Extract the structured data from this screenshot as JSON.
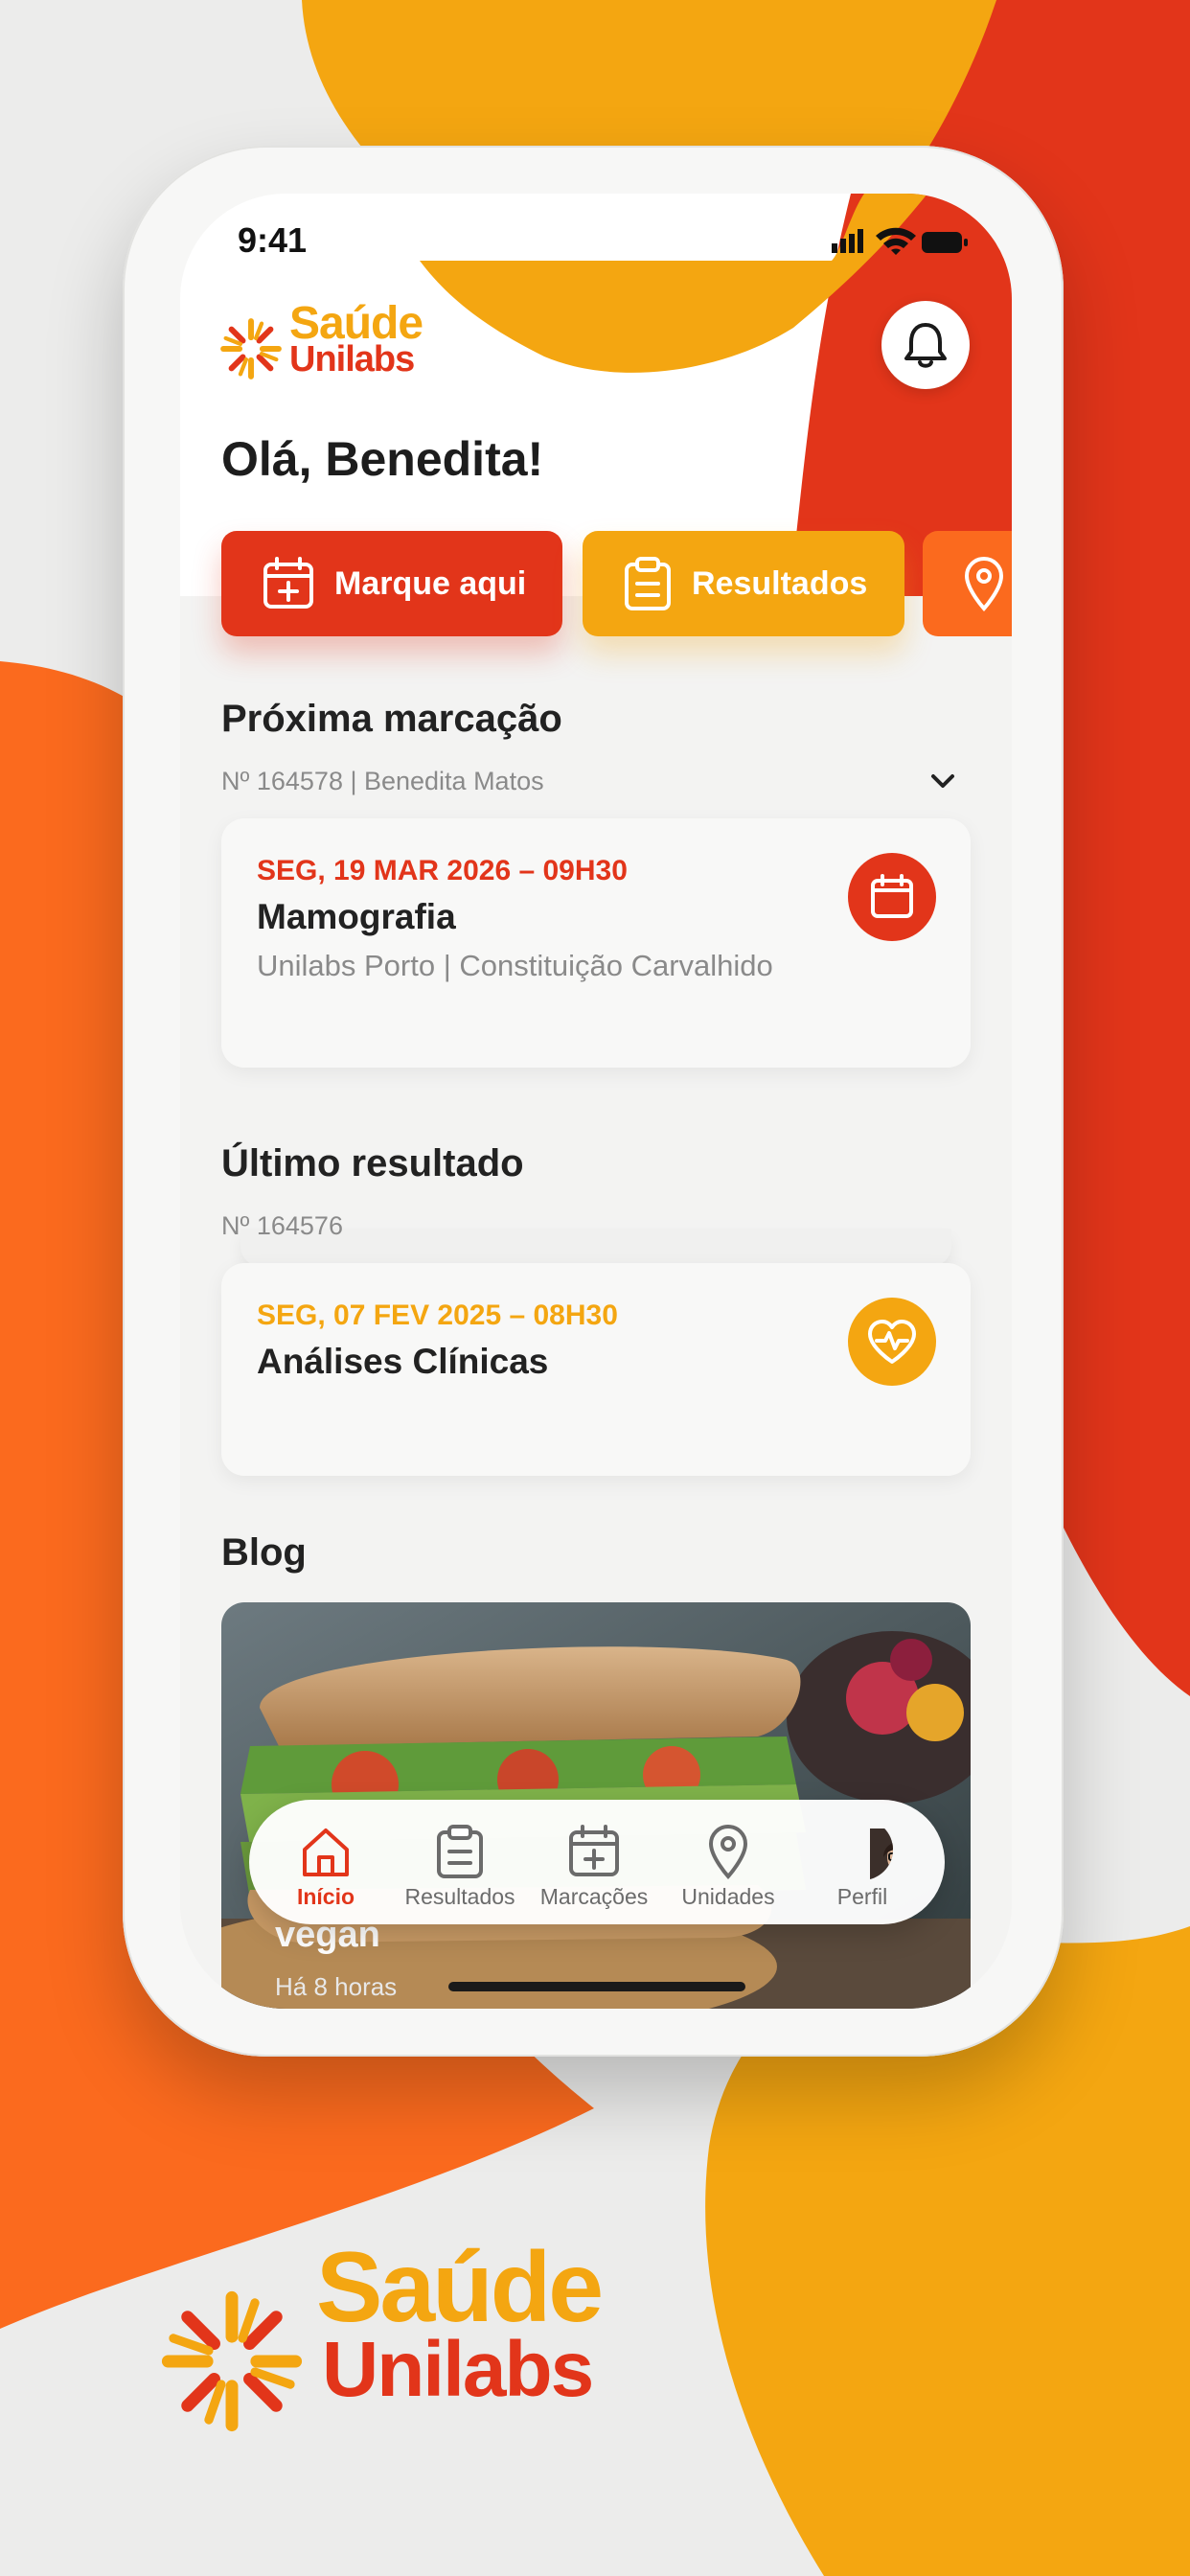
{
  "colors": {
    "red": "#e2351a",
    "yellow": "#f4a611",
    "orange": "#fb6a1e"
  },
  "status": {
    "time": "9:41"
  },
  "brand": {
    "line1": "Saúde",
    "line2": "Unilabs"
  },
  "greeting": "Olá, Benedita!",
  "quick_actions": [
    {
      "label": "Marque aqui",
      "icon": "calendar-plus-icon"
    },
    {
      "label": "Resultados",
      "icon": "clipboard-icon"
    },
    {
      "label": "",
      "icon": "map-pin-icon"
    }
  ],
  "next_appointment": {
    "title": "Próxima marcação",
    "sub": "Nº 164578 | Benedita Matos",
    "date": "SEG, 19 MAR 2026 – 09H30",
    "exam": "Mamografia",
    "location": "Unilabs Porto | Constituição Carvalhido"
  },
  "last_result": {
    "title": "Último resultado",
    "sub": "Nº 164576",
    "date": "SEG, 07 FEV 2025 – 08H30",
    "exam": "Análises Clínicas"
  },
  "blog": {
    "title": "Blog",
    "post_title": "vegan",
    "post_time": "Há 8 horas"
  },
  "tabs": [
    {
      "label": "Início",
      "icon": "home-icon",
      "active": true
    },
    {
      "label": "Resultados",
      "icon": "clipboard-icon",
      "active": false
    },
    {
      "label": "Marcações",
      "icon": "calendar-plus-icon",
      "active": false
    },
    {
      "label": "Unidades",
      "icon": "map-pin-icon",
      "active": false
    },
    {
      "label": "Perfil",
      "icon": "avatar",
      "active": false
    }
  ]
}
